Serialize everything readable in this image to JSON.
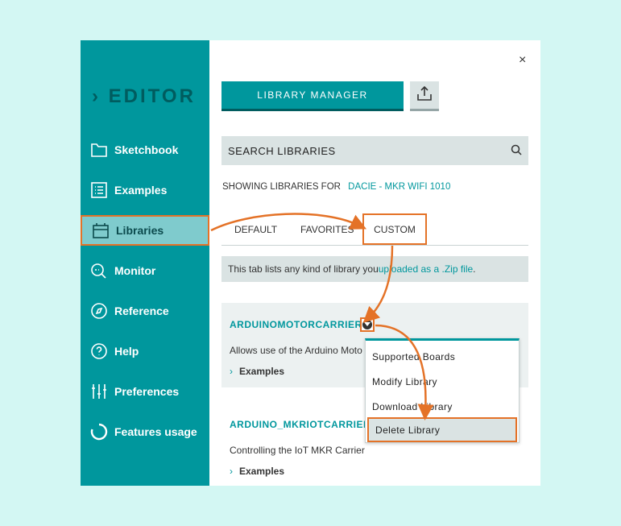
{
  "sidebar": {
    "logo": "EDITOR",
    "items": [
      {
        "label": "Sketchbook",
        "icon": "folder-icon"
      },
      {
        "label": "Examples",
        "icon": "list-icon"
      },
      {
        "label": "Libraries",
        "icon": "library-icon",
        "active": true
      },
      {
        "label": "Monitor",
        "icon": "monitor-icon"
      },
      {
        "label": "Reference",
        "icon": "compass-icon"
      },
      {
        "label": "Help",
        "icon": "help-icon"
      },
      {
        "label": "Preferences",
        "icon": "sliders-icon"
      },
      {
        "label": "Features usage",
        "icon": "usage-icon"
      }
    ]
  },
  "header": {
    "close_label": "×",
    "library_manager_label": "LIBRARY MANAGER"
  },
  "search": {
    "placeholder": "SEARCH LIBRARIES"
  },
  "showing": {
    "prefix": "SHOWING LIBRARIES FOR",
    "board": "DACIE - MKR WIFI 1010"
  },
  "tabs": {
    "default": "DEFAULT",
    "favorites": "FAVORITES",
    "custom": "CUSTOM"
  },
  "info": {
    "text_before": "This tab lists any kind of library you ",
    "link": "uploaded as a .Zip file",
    "text_after": "."
  },
  "libraries": [
    {
      "title": "ARDUINOMOTORCARRIER",
      "description": "Allows use of the Arduino Moto",
      "examples": "Examples"
    },
    {
      "title": "ARDUINO_MKRIOTCARRIER",
      "description": "Controlling the IoT MKR Carrier",
      "examples": "Examples"
    }
  ],
  "menu": {
    "items": [
      "Supported Boards",
      "Modify Library",
      "Download Library",
      "Delete Library"
    ]
  },
  "colors": {
    "teal": "#00979d",
    "highlight": "#e47227",
    "background": "#d3f7f3"
  }
}
